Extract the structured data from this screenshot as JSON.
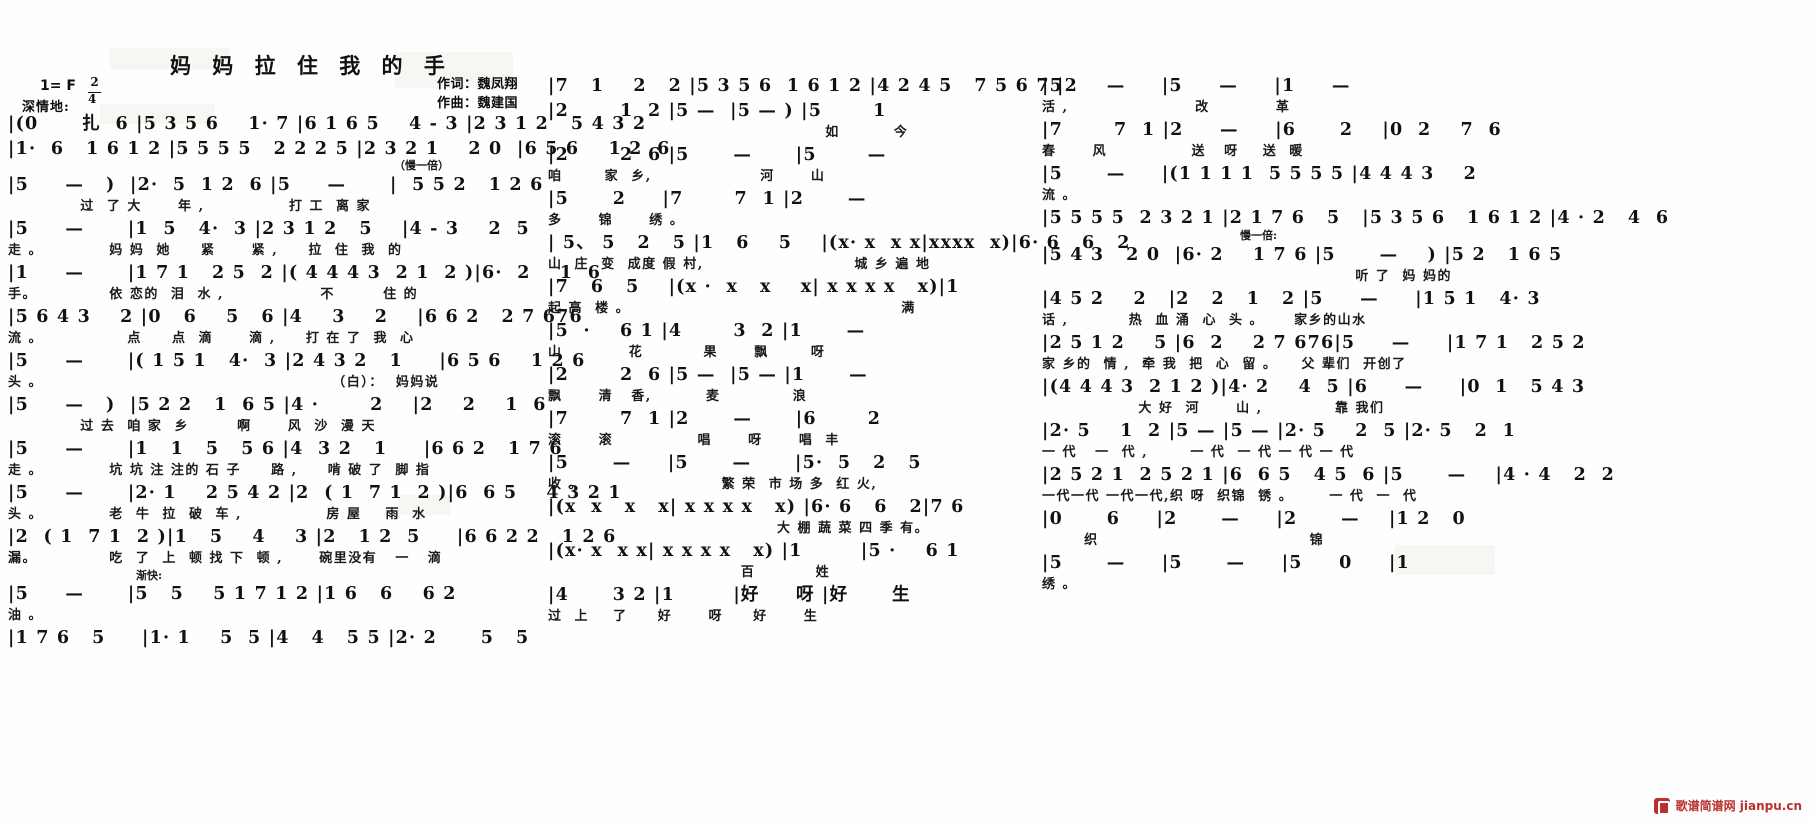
{
  "document": {
    "type": "jianpu-sheet-music",
    "title": "妈 妈 拉 住 我 的 手",
    "key_signature": "1= F",
    "meter": {
      "numerator": "2",
      "denominator": "4"
    },
    "expression_mark": "深情地:",
    "credits": {
      "lyricist": "作词：魏凤翔",
      "composer": "作曲：魏建国"
    },
    "watermark": "歌谱简谱网 jianpu.cn"
  },
  "annotations": {
    "slower_half": "（慢一倍）",
    "slower_half2": "慢一倍:",
    "spoken": "（白）：",
    "spoken_text": "妈妈说",
    "faster": "渐快:"
  },
  "columns": [
    {
      "id": "column-1",
      "systems": [
        {
          "notes": "|(0      扎  6 |5 3 5 6    1· 7 |6 1 6 5    4 - 3 |2 3 1 2   5 4 3 2",
          "lyrics": "",
          "anno": ""
        },
        {
          "notes": "|1·  6   1 6 1 2 |5 5 5 5   2 2 2 5 |2 3 2 1    2 0  |6 5 6    1 2  6",
          "lyrics": "",
          "anno": "（慢一倍）"
        },
        {
          "notes": "|5     —   )  |2·  5  1 2  6 |5     —      |  5 5 2   1 2 6",
          "lyrics": "            过  了 大      年 ,              打 工  离 家"
        },
        {
          "notes": "|5     —      |1  5   4·  3 |2 3 1 2   5    |4 - 3    2  5",
          "lyrics": "走 。           妈 妈  她     紧      紧 ,     拉  住  我  的"
        },
        {
          "notes": "|1     —      |1 7 1   2 5  2 |( 4 4 4 3  2 1  2 )|6·  2    1  6",
          "lyrics": "手。            依 恋的  泪  水 ,                不        住 的"
        },
        {
          "notes": "|5 6 4 3    2 |0   6    5   6 |4    3    2    |6 6 2   2 7 676",
          "lyrics": "流 。              点     点  滴      滴 ,     打 在 了  我  心"
        },
        {
          "notes": "|5     —      |( 1 5 1   4·  3 |2 4 3 2   1     |6 5 6    1 2 6",
          "lyrics": "头 。                                                （白）：  妈妈说"
        },
        {
          "notes": "|5     —   )  |5 2 2   1  6 5 |4 ·       2    |2    2    1  6",
          "lyrics": "            过 去  咱 家  乡        啊      风  沙  漫 天"
        },
        {
          "notes": "|5     —      |1   1   5   5 6 |4  3 2   1     |6 6 2   1 7 6",
          "lyrics": "走 。           坑 坑 注 注的 石 子     路 ,     啃 破 了  脚 指"
        },
        {
          "notes": "|5     —      |2· 1    2 5 4 2 |2  ( 1  7 1  2 )|6  6 5    4 3 2 1",
          "lyrics": "头 。           老  牛  拉  破  车 ,              房 屋    雨  水"
        },
        {
          "notes": "|2  ( 1  7 1  2 )|1   5    4    3 |2   1 2  5     |6 6 2 2   1 2 6",
          "lyrics": "漏。            吃  了  上  顿 找 下  顿 ,      碗里没有   一   滴"
        },
        {
          "notes": "|5     —      |5   5    5 1 7 1 2 |1 6   6    6 2",
          "lyrics": "油 。",
          "anno": "渐快:"
        },
        {
          "notes": "|1 7 6   5     |1· 1    5  5 |4   4   5 5 |2· 2      5   5",
          "lyrics": ""
        }
      ]
    },
    {
      "id": "column-2",
      "systems": [
        {
          "notes": "|7   1    2   2 |5 3 5 6  1 6 1 2 |4 2 4 5   7 5 6 7 |2",
          "lyrics": ""
        },
        {
          "notes": "|2       1  2 |5 —  |5 — ) |5       1",
          "lyrics": "                                              如         今"
        },
        {
          "notes": "|2       2  6 |5      —      |5       —",
          "lyrics": "咱       家  乡,                  河      山"
        },
        {
          "notes": "|5      2     |7       7  1 |2      —",
          "lyrics": "多      锦      绣 。"
        },
        {
          "notes": "| 5、 5   2   5 |1   6    5    |(x· x  x x|xxxx  x)|6· 6   6   2",
          "lyrics": "山  庄  变  成度 假 村,                         城 乡 遍 地"
        },
        {
          "notes": "|7   6   5    |(x ·  x   x    x| x x x x   x)|1",
          "lyrics": "起 高  楼 。                                             满"
        },
        {
          "notes": "|5  ·    6 1 |4       3  2 |1      —",
          "lyrics": "山           花          果      飘       呀"
        },
        {
          "notes": "|2       2  6 |5 —  |5 — |1      —",
          "lyrics": "飘      清   香,         麦            浪"
        },
        {
          "notes": "|7       7  1 |2      —      |6       2",
          "lyrics": "滚      滚              唱      呀      唱  丰"
        },
        {
          "notes": "|5      —     |5      —      |5·  5   2   5",
          "lyrics": "收 。                       繁 荣  市 场 多  红 火,"
        },
        {
          "notes": "|(x  x   x   x| x x x x   x) |6· 6   6   2|7 6",
          "lyrics": "                                      大 棚 蔬 菜 四 季 有。"
        },
        {
          "notes": "|(x· x  x x| x x x x   x) |1        |5 ·    6 1",
          "lyrics": "                                百          姓"
        },
        {
          "notes": "|4      3 2 |1        |好     呀 |好      生",
          "lyrics": "过  上    了     好      呀     好      生"
        }
      ]
    },
    {
      "id": "column-3",
      "systems": [
        {
          "notes": "|5      —     |5     —     |1     —",
          "lyrics": "活 ,                     改           革"
        },
        {
          "notes": "|7       7  1 |2     —     |6      2    |0  2    7  6",
          "lyrics": "春      风              送   呀    送  暖"
        },
        {
          "notes": "|5      —     |(1 1 1 1  5 5 5 5 |4 4 4 3    2",
          "lyrics": "流 。"
        },
        {
          "notes": "|5 5 5 5  2 3 2 1 |2 1 7 6   5   |5 3 5 6   1 6 1 2 |4 · 2   4  6",
          "lyrics": "",
          "anno": "慢一倍:"
        },
        {
          "notes": "|5 4 3   2 0  |6· 2    1 7 6 |5      —    ) |5 2   1 6 5",
          "lyrics": "                                                    听 了  妈 妈的"
        },
        {
          "notes": "|4 5 2    2   |2   2   1   2 |5     —     |1 5 1   4· 3",
          "lyrics": "话 ,          热  血 涌  心  头 。     家乡的山水"
        },
        {
          "notes": "|2 5 1 2    5 |6  2    2 7 676|5     —     |1 7 1   2 5 2",
          "lyrics": "家 乡的  情 ,  牵 我  把  心  留 。    父 辈们  开创了"
        },
        {
          "notes": "|(4 4 4 3  2 1 2 )|4· 2    4  5 |6     —     |0  1   5 4 3",
          "lyrics": "                大 好  河      山 ,            靠 我们"
        },
        {
          "notes": "|2· 5    1  2 |5 — |5 — |2· 5    2  5 |2· 5   2  1",
          "lyrics": "一 代   一  代 ,       一 代  一 代 一 代 一 代"
        },
        {
          "notes": "|2 5 2 1  2 5 2 1 |6  6 5   4 5  6 |5      —    |4 · 4   2  2",
          "lyrics": "一代一代 一代一代,织 呀  织锦  锈 。      一 代  一  代"
        },
        {
          "notes": "|0      6     |2      —     |2      —    |1 2   0",
          "lyrics": "       织                                   锦"
        },
        {
          "notes": "|5      —     |5      —     |5     0     |1",
          "lyrics": "绣 。"
        }
      ]
    }
  ],
  "lyric_text_full": {
    "verse1": "过了大年，打工离家走。妈妈她紧紧，拉住我的手。依恋的泪水，不住的流。点点滴滴，打在了我心头。",
    "spoken": "（白）：妈妈说——",
    "verse2": "过去咱家乡啊风沙漫天走。坑坑注注的石子路，啃破了脚指头。老牛拉破车，房屋雨水漏。吃了上顿找下顿，碗里没有一滴油。",
    "verse3": "如今咱家乡，河山多锦绣。山庄变成度假村，城乡遍地起高楼。满山花果飘呀飘清香，麦浪滚滚唱丰收。繁荣市场多红火，大棚蔬菜四季有。百姓过上了好呀好生活，改革春风送呀送暖流。",
    "verse4": "听了妈妈的话，热血涌心头。家乡的山水家乡的情，牵我把心留。父辈们开创了大好河山，靠我们一代一代，一代一代一代一代一代一代，织呀织锦锈。一代一代织锦绣。"
  }
}
